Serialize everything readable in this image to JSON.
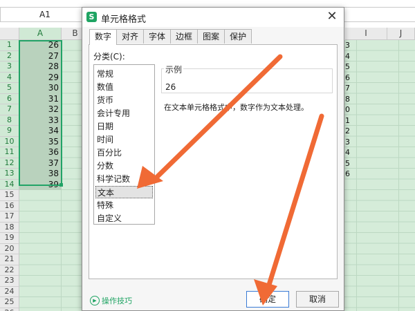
{
  "spreadsheet": {
    "name_box": "A1",
    "columns": [
      "A",
      "B",
      "I",
      "J"
    ],
    "rows": [
      "1",
      "2",
      "3",
      "4",
      "5",
      "6",
      "7",
      "8",
      "9",
      "10",
      "11",
      "12",
      "13",
      "14",
      "15",
      "16",
      "17",
      "18",
      "19",
      "20",
      "21",
      "22",
      "23",
      "24",
      "25",
      "26"
    ],
    "column_a_values": [
      "26",
      "27",
      "28",
      "29",
      "30",
      "31",
      "32",
      "33",
      "34",
      "35",
      "36",
      "37",
      "38",
      "39"
    ],
    "right_partial_values": [
      "3",
      "4",
      "5",
      "6",
      "7",
      "8",
      "0",
      "1",
      "2",
      "3",
      "4",
      "5",
      "6"
    ]
  },
  "dialog": {
    "app_icon": "S",
    "title": "单元格格式",
    "close_label": "✕",
    "tabs": [
      "数字",
      "对齐",
      "字体",
      "边框",
      "图案",
      "保护"
    ],
    "category_label": "分类(C):",
    "categories": [
      "常规",
      "数值",
      "货币",
      "会计专用",
      "日期",
      "时间",
      "百分比",
      "分数",
      "科学记数",
      "文本",
      "特殊",
      "自定义"
    ],
    "selected_category": "文本",
    "sample_label": "示例",
    "sample_value": "26",
    "description": "在文本单元格格式中，数字作为文本处理。",
    "tips_label": "操作技巧",
    "ok_label": "确定",
    "cancel_label": "取消"
  },
  "colors": {
    "sheet_green": "#d5ecd9",
    "selection_green": "#21a366",
    "arrow_orange": "#f06a35"
  }
}
